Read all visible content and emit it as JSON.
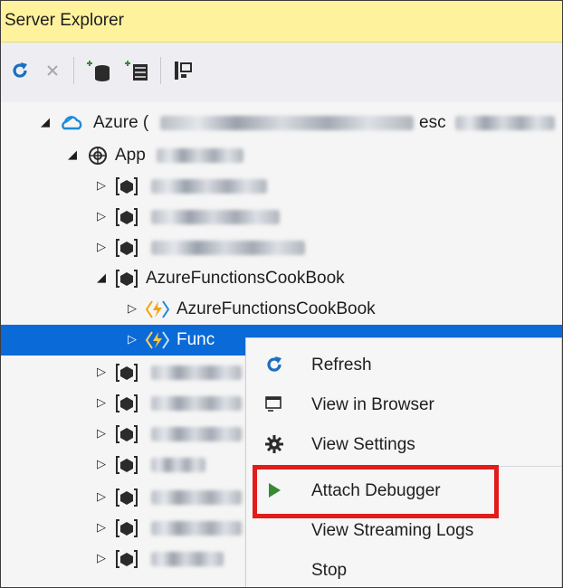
{
  "panel": {
    "title": "Server Explorer"
  },
  "toolbar": {
    "icons": [
      "refresh-icon",
      "stop-icon",
      "connect-database-icon",
      "connect-server-icon",
      "properties-icon"
    ]
  },
  "tree": {
    "azure_label": "Azure (",
    "azure_label_tail": "esc",
    "app_service_label": "App",
    "resource_group_label": "AzureFunctionsCookBook",
    "function_app_label": "AzureFunctionsCookBook",
    "selected_app_label": "Func"
  },
  "context_menu": {
    "items": [
      {
        "label": "Refresh",
        "icon": "refresh-icon"
      },
      {
        "label": "View in Browser",
        "icon": "browser-icon"
      },
      {
        "label": "View Settings",
        "icon": "gear-icon"
      },
      {
        "label": "Attach Debugger",
        "icon": "play-icon"
      },
      {
        "label": "View Streaming Logs",
        "icon": ""
      },
      {
        "label": "Stop",
        "icon": ""
      }
    ]
  },
  "colors": {
    "title_bar": "#fff29d",
    "selection": "#0a6ad8",
    "highlight_box": "#e21b1b",
    "play_green": "#388a34",
    "refresh_blue": "#1a6fbf"
  }
}
